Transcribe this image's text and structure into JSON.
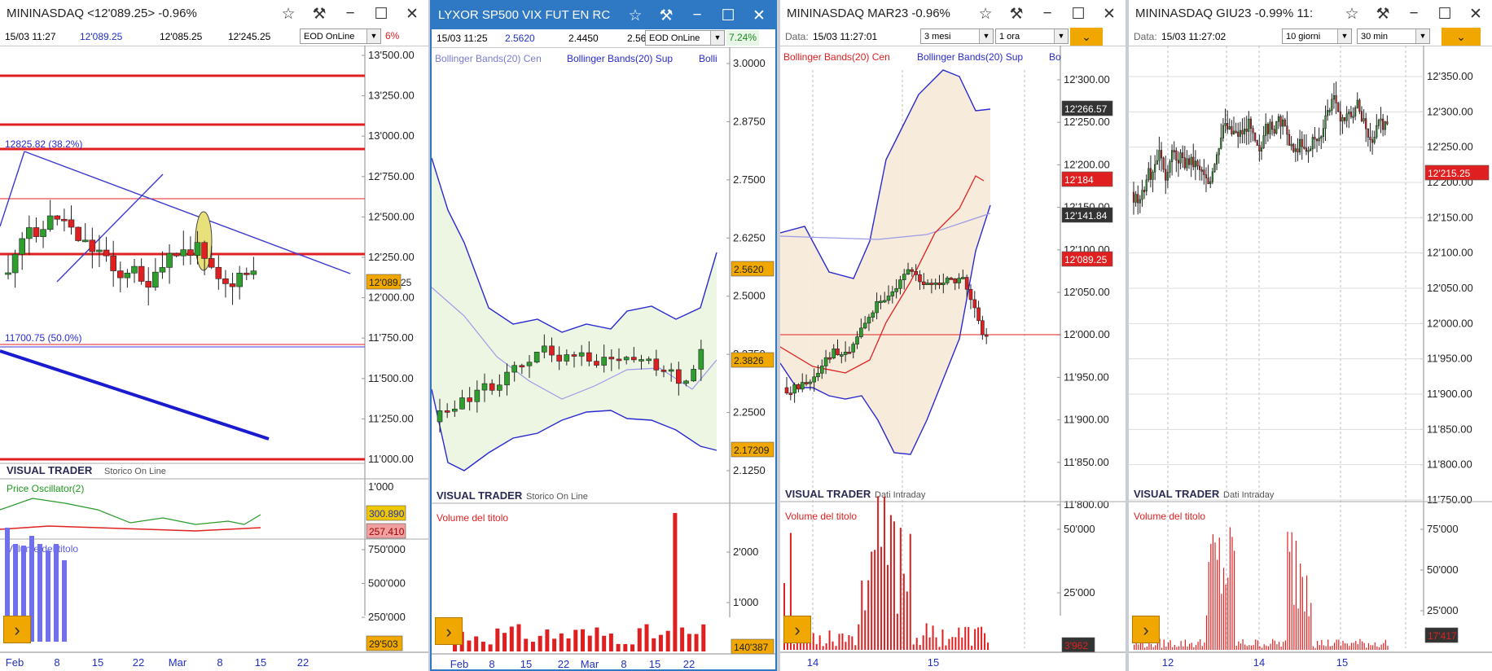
{
  "windows": [
    {
      "title": "MININASDAQ <12'089.25> -0.96%",
      "info": {
        "datetime": "15/03 11:27",
        "last": "12'089.25",
        "low": "12'085.25",
        "high": "12'245.25",
        "mode": "EOD OnLine",
        "pct": "6%"
      },
      "price_axis": [
        "13'500.00",
        "13'250.00",
        "13'000.00",
        "12'750.00",
        "12'500.00",
        "12'250.00",
        "12'000.00",
        "11'750.00",
        "11'500.00",
        "11'250.00",
        "11'000.00"
      ],
      "fib_labels": [
        "12825.82 (38.2%)",
        "11700.75 (50.0%)"
      ],
      "last_badge": "12'089.25",
      "brand": "VISUAL TRADER",
      "brand_sub": "Storico On Line",
      "osc_label": "Price Oscillator(2)",
      "osc_axis": "1'000",
      "osc_badge1": "300.890",
      "osc_badge2": "257.410",
      "vol_label": "Volume del titolo",
      "vol_axis": [
        "750'000",
        "500'000",
        "250'000"
      ],
      "vol_badge": "29'503",
      "x_labels": [
        "Feb",
        "8",
        "15",
        "22",
        "Mar",
        "8",
        "15",
        "22"
      ]
    },
    {
      "title": "LYXOR SP500 VIX FUT EN RC",
      "info": {
        "datetime": "15/03 11:25",
        "last": "2.5620",
        "low": "2.4450",
        "high": "2.56",
        "mode": "EOD OnLine",
        "pct": "7.24%"
      },
      "legend": [
        "Bollinger Bands(20) Cen",
        "Bollinger Bands(20) Sup",
        "Bolli"
      ],
      "price_axis": [
        "3.0000",
        "2.8750",
        "2.7500",
        "2.6250",
        "2.5000",
        "2.3750",
        "2.2500",
        "2.1250"
      ],
      "badges": [
        "2.5620",
        "2.3826",
        "2.17209"
      ],
      "brand": "VISUAL TRADER",
      "brand_sub": "Storico On Line",
      "vol_label": "Volume del titolo",
      "vol_axis": [
        "2'000",
        "1'000"
      ],
      "vol_badge": "140'387",
      "x_labels": [
        "Feb",
        "8",
        "15",
        "22",
        "Mar",
        "8",
        "15",
        "22"
      ]
    },
    {
      "title": "MININASDAQ MAR23 -0.96%",
      "info": {
        "date_label": "Data:",
        "datetime": "15/03 11:27:01",
        "period": "3 mesi",
        "interval": "1 ora"
      },
      "legend": [
        "Bollinger Bands(20) Cen",
        "Bollinger Bands(20) Sup",
        "Bo"
      ],
      "price_axis": [
        "12'300.00",
        "12'250.00",
        "12'200.00",
        "12'150.00",
        "12'100.00",
        "12'050.00",
        "12'000.00",
        "11'950.00",
        "11'900.00",
        "11'850.00",
        "11'800.00"
      ],
      "badges": [
        "12'266.57",
        "12'184",
        "12'141.84",
        "12'089.25"
      ],
      "brand": "VISUAL TRADER",
      "brand_sub": "Dati Intraday",
      "vol_label": "Volume del titolo",
      "vol_axis": [
        "50'000",
        "25'000"
      ],
      "vol_badge": "3'962",
      "x_labels": [
        "14",
        "15"
      ]
    },
    {
      "title": "MININASDAQ GIU23 -0.99% 11:",
      "info": {
        "date_label": "Data:",
        "datetime": "15/03 11:27:02",
        "period": "10 giorni",
        "interval": "30 min"
      },
      "price_axis": [
        "12'350.00",
        "12'300.00",
        "12'250.00",
        "12'200.00",
        "12'150.00",
        "12'100.00",
        "12'050.00",
        "12'000.00",
        "11'950.00",
        "11'900.00",
        "11'850.00",
        "11'800.00",
        "11'750.00"
      ],
      "last_badge": "12'215.25",
      "brand": "VISUAL TRADER",
      "brand_sub": "Dati Intraday",
      "vol_label": "Volume del titolo",
      "vol_axis": [
        "75'000",
        "50'000",
        "25'000"
      ],
      "vol_badge": "17'417",
      "x_labels": [
        "12",
        "14",
        "15"
      ]
    }
  ],
  "colors": {
    "up": "#2e9e2e",
    "down": "#e02020",
    "accent": "#2f78c4",
    "badge_orange": "#f0a800",
    "badge_dark": "#222222",
    "band_blue": "#2a2ad0"
  },
  "icons": [
    "star-icon",
    "pin-icon",
    "minimize-icon",
    "maximize-icon",
    "close-icon",
    "chevron-down-icon",
    "chevron-right-icon"
  ]
}
